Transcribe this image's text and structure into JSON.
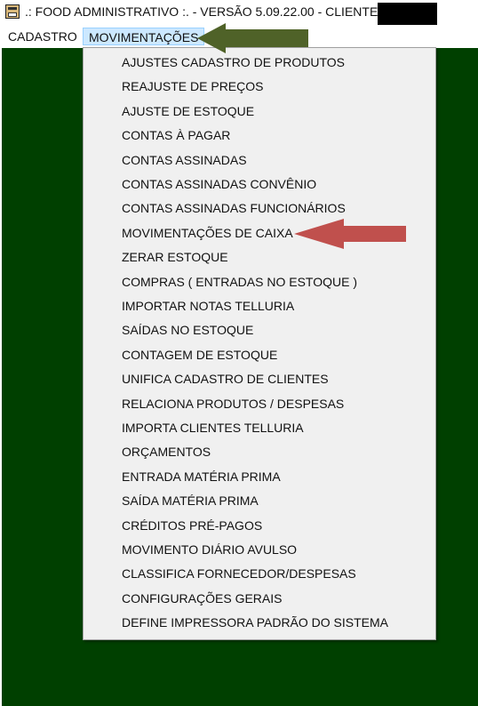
{
  "window": {
    "title": ".: FOOD ADMINISTRATIVO :.  - VERSÃO 5.09.22.00 - CLIENTE:",
    "app_icon": "app-icon"
  },
  "menubar": {
    "items": [
      {
        "label": "CADASTRO"
      },
      {
        "label": "MOVIMENTAÇÕES"
      }
    ]
  },
  "dropdown": {
    "items": [
      {
        "label": "AJUSTES CADASTRO DE PRODUTOS"
      },
      {
        "label": "REAJUSTE DE PREÇOS"
      },
      {
        "label": "AJUSTE DE ESTOQUE"
      },
      {
        "label": "CONTAS À PAGAR"
      },
      {
        "label": "CONTAS ASSINADAS"
      },
      {
        "label": "CONTAS ASSINADAS CONVÊNIO"
      },
      {
        "label": "CONTAS ASSINADAS FUNCIONÁRIOS"
      },
      {
        "label": "MOVIMENTAÇÕES DE CAIXA"
      },
      {
        "label": "ZERAR ESTOQUE"
      },
      {
        "label": "COMPRAS ( ENTRADAS NO ESTOQUE )"
      },
      {
        "label": "IMPORTAR NOTAS TELLURIA"
      },
      {
        "label": "SAÍDAS NO ESTOQUE"
      },
      {
        "label": "CONTAGEM DE ESTOQUE"
      },
      {
        "label": "UNIFICA CADASTRO DE CLIENTES"
      },
      {
        "label": "RELACIONA PRODUTOS / DESPESAS"
      },
      {
        "label": "IMPORTA CLIENTES TELLURIA"
      },
      {
        "label": "ORÇAMENTOS"
      },
      {
        "label": "ENTRADA MATÉRIA PRIMA"
      },
      {
        "label": "SAÍDA MATÉRIA PRIMA"
      },
      {
        "label": "CRÉDITOS PRÉ-PAGOS"
      },
      {
        "label": "MOVIMENTO DIÁRIO AVULSO"
      },
      {
        "label": "CLASSIFICA FORNECEDOR/DESPESAS"
      },
      {
        "label": "CONFIGURAÇÕES GERAIS"
      },
      {
        "label": "DEFINE IMPRESSORA PADRÃO DO SISTEMA"
      }
    ]
  },
  "colors": {
    "desktop": "#004000",
    "menu_highlight": "#cce8ff",
    "arrow_green": "#4f6228",
    "arrow_red": "#c0504d"
  }
}
